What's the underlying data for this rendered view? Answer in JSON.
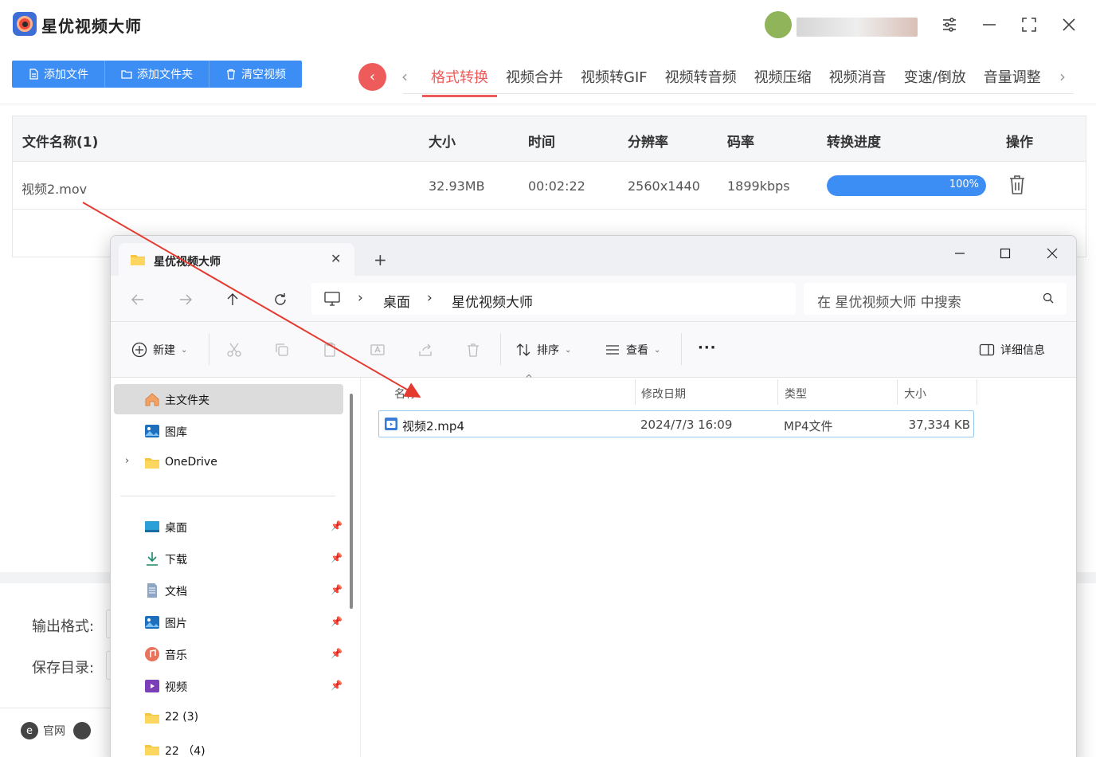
{
  "app": {
    "title": "星优视频大师",
    "toolbar": {
      "add_file": "添加文件",
      "add_folder": "添加文件夹",
      "clear": "清空视频"
    },
    "tabs": [
      "格式转换",
      "视频合并",
      "视频转GIF",
      "视频转音频",
      "视频压缩",
      "视频消音",
      "变速/倒放",
      "音量调整"
    ],
    "active_tab": "格式转换",
    "table": {
      "headers": {
        "name": "文件名称(1)",
        "size": "大小",
        "time": "时间",
        "resolution": "分辨率",
        "bitrate": "码率",
        "progress": "转换进度",
        "action": "操作"
      },
      "rows": [
        {
          "name": "视频2.mov",
          "size": "32.93MB",
          "time": "00:02:22",
          "resolution": "2560x1440",
          "bitrate": "1899kbps",
          "progress_text": "100%",
          "progress": 1.0
        }
      ]
    },
    "output_format_label": "输出格式:",
    "save_dir_label": "保存目录:",
    "footer": {
      "website": "官网"
    },
    "colors": {
      "accent_blue": "#3c8df4",
      "accent_red": "#ee5b5b"
    }
  },
  "explorer": {
    "tab_title": "星优视频大师",
    "breadcrumb": [
      "桌面",
      "星优视频大师"
    ],
    "search_placeholder": "在 星优视频大师 中搜索",
    "commands": {
      "new": "新建",
      "sort": "排序",
      "view": "查看",
      "details": "详细信息"
    },
    "nav": {
      "home": "主文件夹",
      "gallery": "图库",
      "onedrive": "OneDrive",
      "desktop": "桌面",
      "downloads": "下载",
      "documents": "文档",
      "pictures": "图片",
      "music": "音乐",
      "videos": "视频",
      "folder1": "22 (3)",
      "folder2": "22 （4)"
    },
    "columns": {
      "name": "名称",
      "modified": "修改日期",
      "type": "类型",
      "size": "大小"
    },
    "files": [
      {
        "name": "视频2.mp4",
        "modified": "2024/7/3 16:09",
        "type": "MP4文件",
        "size": "37,334 KB"
      }
    ]
  }
}
